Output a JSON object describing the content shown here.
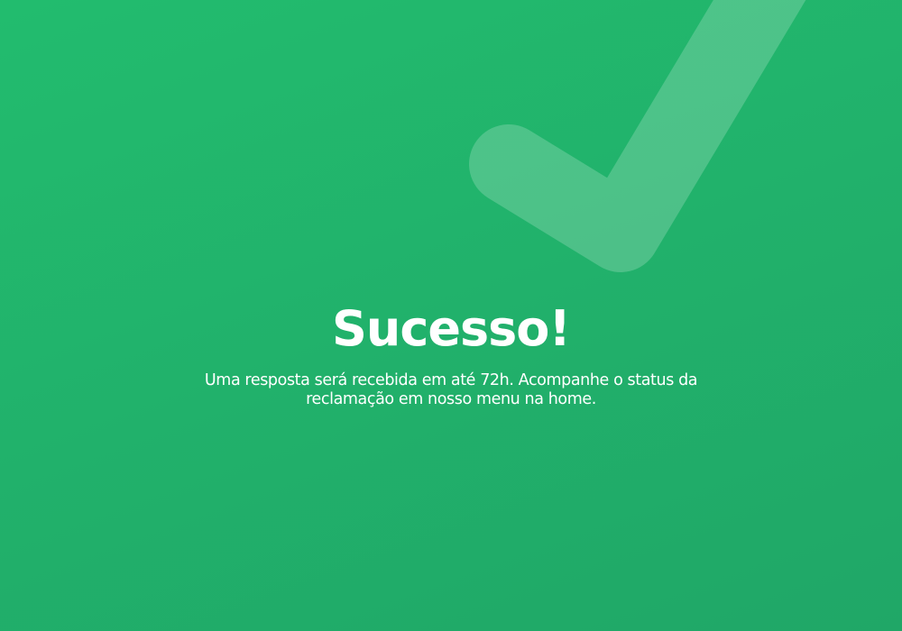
{
  "screen": {
    "title": "Sucesso!",
    "message": "Uma resposta será recebida em até 72h. Acompanhe o status da reclamação em nosso menu na home."
  },
  "icons": {
    "background_check": "checkmark-icon"
  },
  "colors": {
    "background": "#21b16b",
    "text": "#ffffff",
    "check_overlay": "rgba(255,255,255,0.2)"
  }
}
